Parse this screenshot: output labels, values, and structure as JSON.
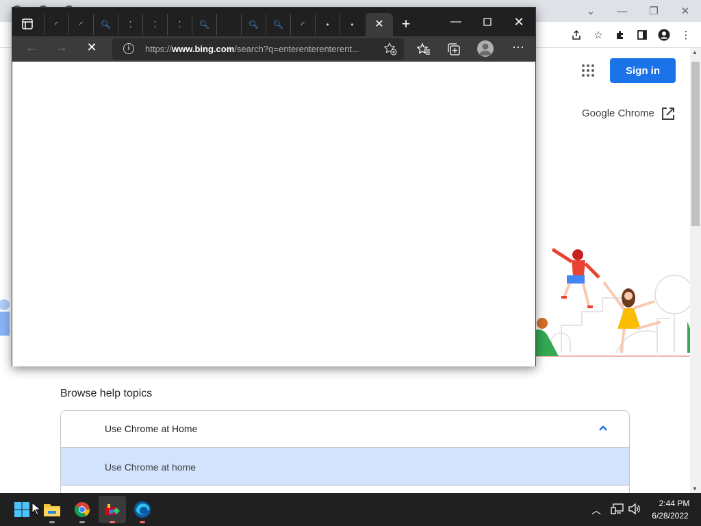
{
  "chrome_page": {
    "sign_in_label": "Sign in",
    "google_chrome_link": "Google Chrome",
    "browse_help_title": "Browse help topics",
    "help_section_header": "Use Chrome at Home",
    "help_section_item": "Use Chrome at home",
    "accent_color": "#1a73e8",
    "icons": [
      "apps-grid-icon",
      "external-link-icon",
      "chevron-up-icon",
      "share-icon",
      "star-icon",
      "extensions-icon",
      "side-panel-icon",
      "profile-icon",
      "more-icon"
    ]
  },
  "edge_window": {
    "address_prefix": "https://",
    "address_domain": "www.bing.com",
    "address_path": "/search?q=enterenterenterent...",
    "tab_count": 14,
    "active_tab": "close",
    "icons": [
      "tab-actions-icon",
      "back-icon",
      "forward-icon",
      "stop-loading-icon",
      "info-icon",
      "favorite-add-icon",
      "favorites-icon",
      "collections-icon",
      "profile-icon",
      "more-icon",
      "new-tab-icon",
      "minimize-icon",
      "maximize-icon",
      "close-icon"
    ]
  },
  "taskbar": {
    "time": "2:44 PM",
    "date": "6/28/2022",
    "apps": [
      "start-icon",
      "file-explorer-icon",
      "chrome-icon",
      "app-icon",
      "edge-icon"
    ]
  }
}
